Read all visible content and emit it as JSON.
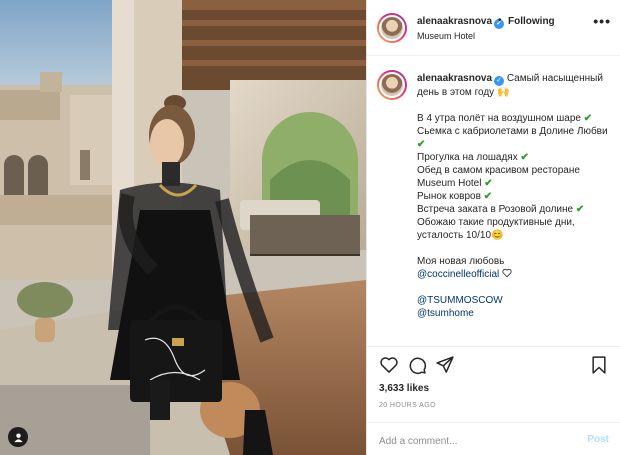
{
  "post": {
    "username": "alenaakrasnova",
    "separator": "•",
    "follow_label": "Following",
    "location": "Museum Hotel",
    "more_glyph": "•••"
  },
  "caption": {
    "username": "alenaakrasnova",
    "intro": "Самый насыщенный день в этом году",
    "intro_emoji": "🙌",
    "lines": [
      {
        "text": "В 4 утра полёт на воздушном шаре",
        "check": "✔"
      },
      {
        "text": "Сьемка с кабриолетами в Долине Любви",
        "check": "✔"
      },
      {
        "text": "Прогулка на лошадях",
        "check": "✔"
      },
      {
        "text": "Обед в самом красивом ресторане Museum Hotel",
        "check": "✔"
      },
      {
        "text": "Рынок ковров",
        "check": "✔"
      },
      {
        "text": "Встреча заката в Розовой долине",
        "check": "✔"
      }
    ],
    "closing": "Обожаю такие продуктивные дни, усталость 10/10",
    "closing_emoji": "😊",
    "love_line": "Моя новая любовь",
    "brand_mention": "@coccinelleofficial",
    "mention_2": "@TSUMMOSCOW",
    "mention_3": "@tsumhome"
  },
  "engagement": {
    "likes": "3,633 likes",
    "timestamp": "20 HOURS AGO",
    "comment_placeholder": "Add a comment...",
    "post_label": "Post"
  },
  "colors": {
    "link": "#00376b",
    "verified": "#3897f0",
    "check": "#2f9e2f",
    "post_disabled": "#b2dffc"
  },
  "icons": {
    "like": "heart-icon",
    "comment": "comment-icon",
    "share": "paper-plane-icon",
    "save": "bookmark-icon",
    "tag": "user-tag-icon",
    "verified": "verified-badge-icon"
  }
}
